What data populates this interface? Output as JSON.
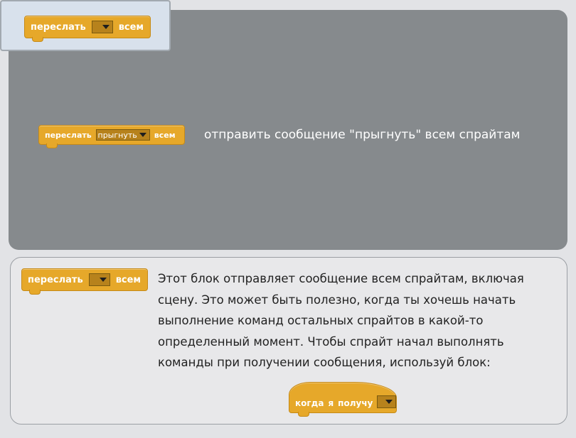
{
  "preview": {
    "block": {
      "verb": "переслать",
      "dropdown_value": "",
      "suffix": "всем"
    }
  },
  "example": {
    "block": {
      "verb": "переслать",
      "dropdown_value": "прыгнуть",
      "suffix": "всем"
    },
    "description": "отправить сообщение \"прыгнуть\" всем спрайтам"
  },
  "help": {
    "block": {
      "verb": "переслать",
      "dropdown_value": "",
      "suffix": "всем"
    },
    "lines": [
      "Этот блок отправляет сообщение всем спрайтам, включая",
      "сцену. Это может быть полезно, когда ты хочешь начать",
      "выполнение команд остальных спрайтов в какой-то",
      "определенный момент. Чтобы спрайт начал выполнять",
      "команды при получении сообщения, используй блок:"
    ],
    "hat_block": {
      "words": [
        "когда",
        "я",
        "получу"
      ],
      "dropdown_value": ""
    }
  },
  "colors": {
    "block": "#e6a82a",
    "panel": "#868a8d",
    "background": "#e2e3e6"
  },
  "icons": [
    "dropdown-arrow-icon"
  ]
}
